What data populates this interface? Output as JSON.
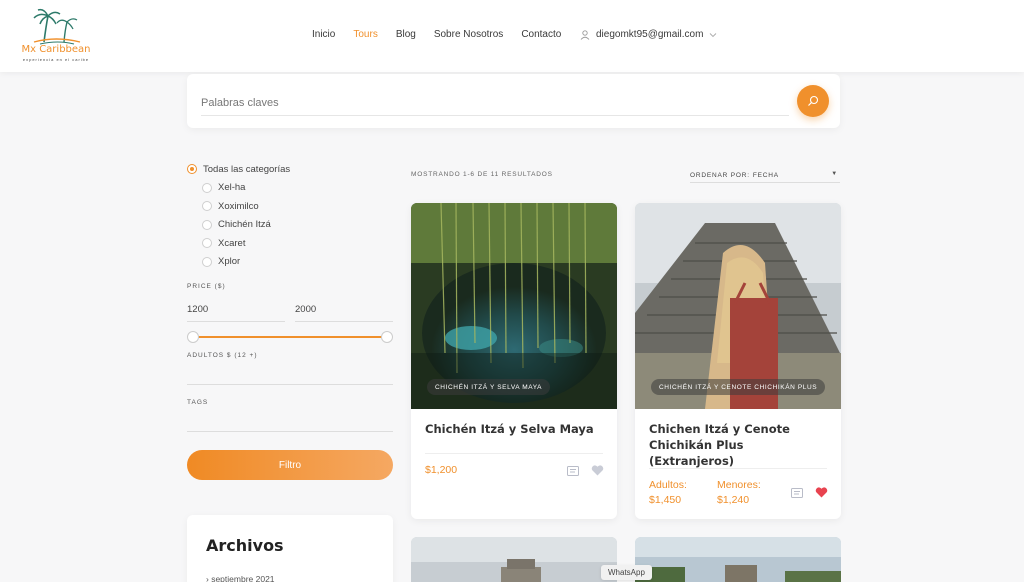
{
  "brand": {
    "name": "Mx Caribbean",
    "tagline": "experiencia en el caribe"
  },
  "nav": {
    "items": [
      {
        "label": "Inicio"
      },
      {
        "label": "Tours"
      },
      {
        "label": "Blog"
      },
      {
        "label": "Sobre Nosotros"
      },
      {
        "label": "Contacto"
      }
    ],
    "active": "Tours",
    "user_email": "diegomkt95@gmail.com"
  },
  "search": {
    "placeholder": "Palabras claves"
  },
  "filters": {
    "categories": [
      {
        "label": "Todas las categorías",
        "checked": true
      },
      {
        "label": "Xel-ha",
        "checked": false
      },
      {
        "label": "Xoximilco",
        "checked": false
      },
      {
        "label": "Chichén Itzá",
        "checked": false
      },
      {
        "label": "Xcaret",
        "checked": false
      },
      {
        "label": "Xplor",
        "checked": false
      }
    ],
    "price_label": "PRICE ($)",
    "price_min": "1200",
    "price_max": "2000",
    "adults_label": "ADULTOS $ (12 +)",
    "tags_label": "TAGS",
    "button_label": "Filtro"
  },
  "archives": {
    "title": "Archivos",
    "items": [
      "septiembre 2021"
    ]
  },
  "results": {
    "count_text": "MOSTRANDO 1-6 DE 11 RESULTADOS",
    "sort_label": "ORDENAR POR:",
    "sort_value": "FECHA"
  },
  "cards": [
    {
      "tag": "CHICHÉN ITZÁ Y SELVA MAYA",
      "title": "Chichén Itzá y Selva Maya",
      "price": "$1,200",
      "favorited": false
    },
    {
      "tag": "CHICHÉN ITZÁ Y CENOTE CHICHIKÁN PLUS",
      "title": "Chichen Itzá y Cenote Chichikán Plus (Extranjeros)",
      "adult_label": "Adultos:",
      "adult_price": "$1,450",
      "minor_label": "Menores:",
      "minor_price": "$1,240",
      "favorited": true
    }
  ],
  "whatsapp": "WhatsApp",
  "colors": {
    "accent": "#f0902c",
    "heart_active": "#e8434f",
    "heart_inactive": "#c9ccd6"
  }
}
